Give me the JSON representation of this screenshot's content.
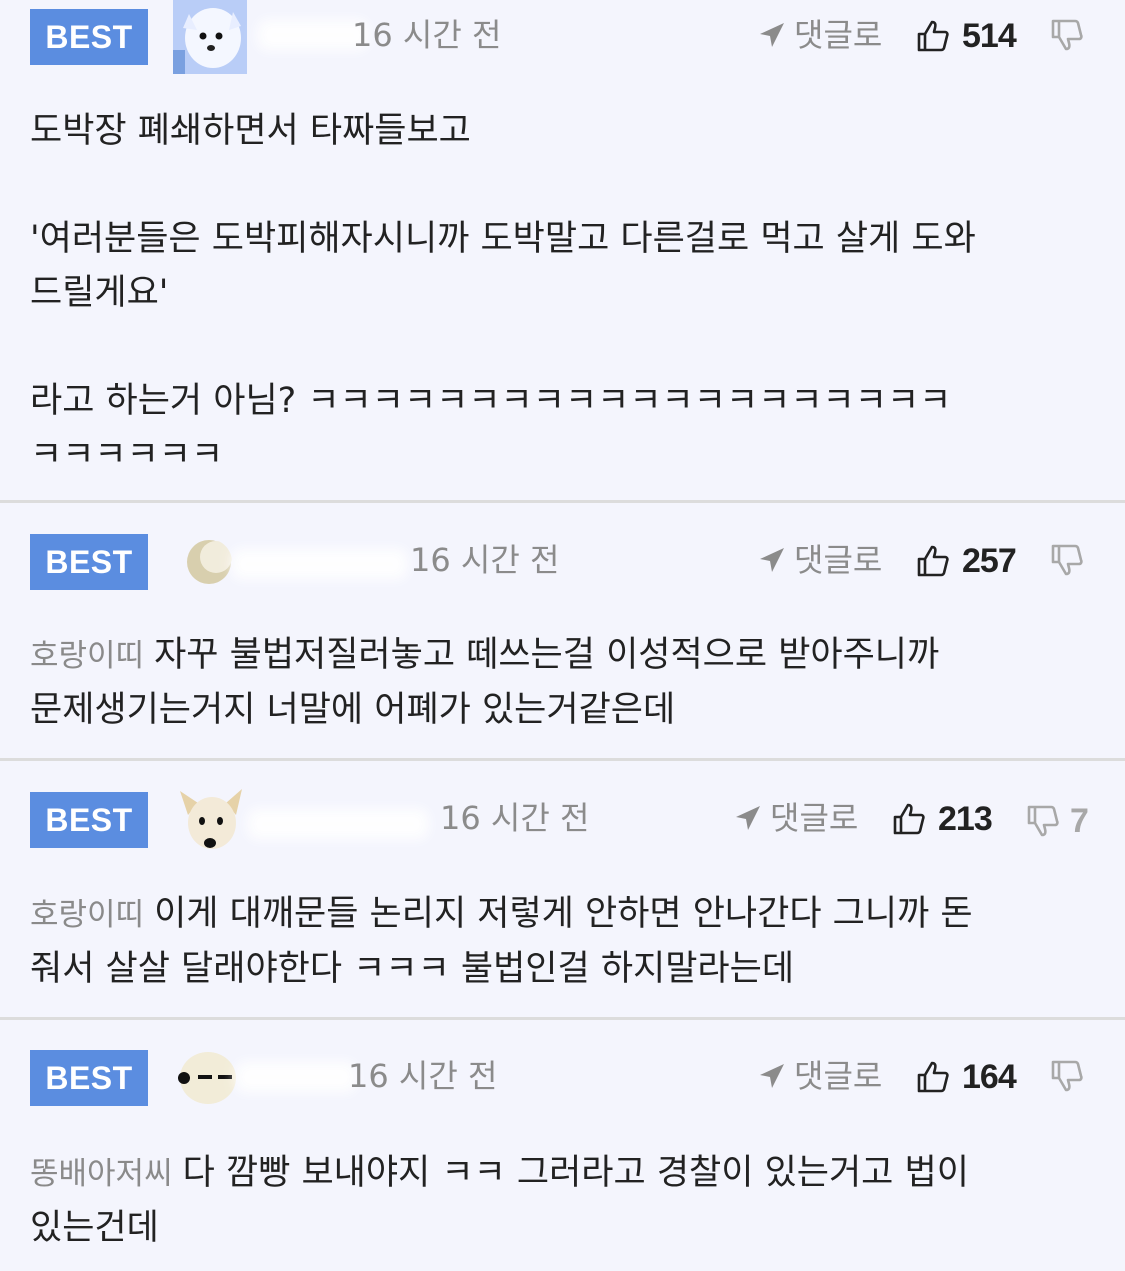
{
  "comments": [
    {
      "badge": "BEST",
      "time": "16 시간 전",
      "reply_label": "댓글로",
      "likes": "514",
      "dislikes": "",
      "mention": "",
      "lines": [
        "도박장 폐쇄하면서 타짜들보고",
        "",
        "'여러분들은 도박피해자시니까 도박말고 다른걸로 먹고 살게 도와",
        "드릴게요'",
        "",
        "라고 하는거 아님? ㅋㅋㅋㅋㅋㅋㅋㅋㅋㅋㅋㅋㅋㅋㅋㅋㅋㅋㅋㅋ",
        "ㅋㅋㅋㅋㅋㅋ"
      ]
    },
    {
      "badge": "BEST",
      "time": "16 시간 전",
      "reply_label": "댓글로",
      "likes": "257",
      "dislikes": "",
      "mention": "호랑이띠",
      "lines": [
        "자꾸 불법저질러놓고 떼쓰는걸 이성적으로 받아주니까",
        "문제생기는거지 너말에 어폐가 있는거같은데"
      ]
    },
    {
      "badge": "BEST",
      "time": "16 시간 전",
      "reply_label": "댓글로",
      "likes": "213",
      "dislikes": "7",
      "mention": "호랑이띠",
      "lines": [
        "이게 대깨문들 논리지 저렇게 안하면 안나간다 그니까 돈",
        "줘서 살살 달래야한다 ㅋㅋㅋ 불법인걸 하지말라는데"
      ]
    },
    {
      "badge": "BEST",
      "time": "16 시간 전",
      "reply_label": "댓글로",
      "likes": "164",
      "dislikes": "",
      "mention": "똥배아저씨",
      "lines": [
        "다 깜빵 보내야지 ㅋㅋ 그러라고 경찰이 있는거고 법이",
        "있는건데"
      ]
    }
  ],
  "icons": {
    "reply": "arrow-reply-icon",
    "like": "thumbs-up-icon",
    "dislike": "thumbs-down-icon"
  },
  "colors": {
    "badge": "#5b8de0",
    "background": "#f4f5fd",
    "muted": "#8b8b8b"
  }
}
